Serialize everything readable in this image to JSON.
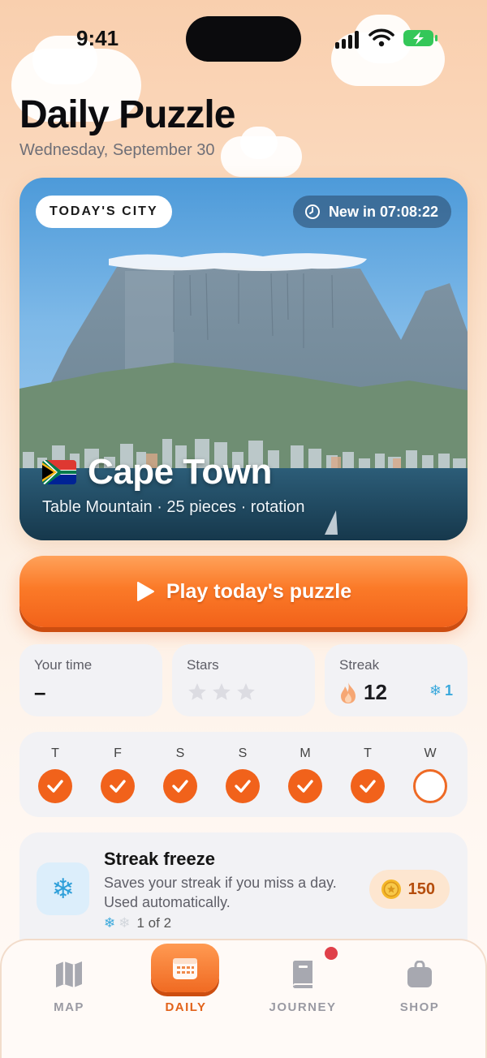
{
  "status_bar": {
    "time": "9:41"
  },
  "header": {
    "title": "Daily Puzzle",
    "date": "Wednesday, September 30"
  },
  "hero": {
    "tag": "TODAY'S CITY",
    "timer": "New in 07:08:22",
    "city": "Cape Town",
    "meta": "Table Mountain · 25 pieces · rotation",
    "flag_icon": "south-africa-flag"
  },
  "play_button": {
    "label": "Play today's puzzle",
    "icon": "play-icon"
  },
  "stats": {
    "time": {
      "label": "Your time",
      "value": "–"
    },
    "stars": {
      "label": "Stars",
      "earned": 0,
      "total": 3
    },
    "streak": {
      "label": "Streak",
      "value": "12",
      "freezes": "1"
    }
  },
  "week": {
    "days": [
      {
        "letter": "T",
        "status": "done"
      },
      {
        "letter": "F",
        "status": "done"
      },
      {
        "letter": "S",
        "status": "done"
      },
      {
        "letter": "S",
        "status": "done"
      },
      {
        "letter": "M",
        "status": "done"
      },
      {
        "letter": "T",
        "status": "done"
      },
      {
        "letter": "W",
        "status": "today"
      }
    ]
  },
  "freeze_card": {
    "title": "Streak freeze",
    "description": "Saves your streak if you miss a day. Used automatically.",
    "stock": "1 of 2",
    "price": "150"
  },
  "tabs": [
    {
      "label": "MAP",
      "icon": "map-icon"
    },
    {
      "label": "DAILY",
      "icon": "calendar-icon",
      "active": true
    },
    {
      "label": "JOURNEY",
      "icon": "book-icon",
      "badge": true
    },
    {
      "label": "SHOP",
      "icon": "bag-icon"
    }
  ],
  "colors": {
    "accent": "#f1621b",
    "ice": "#39a8dc",
    "card": "#f2f2f5"
  }
}
